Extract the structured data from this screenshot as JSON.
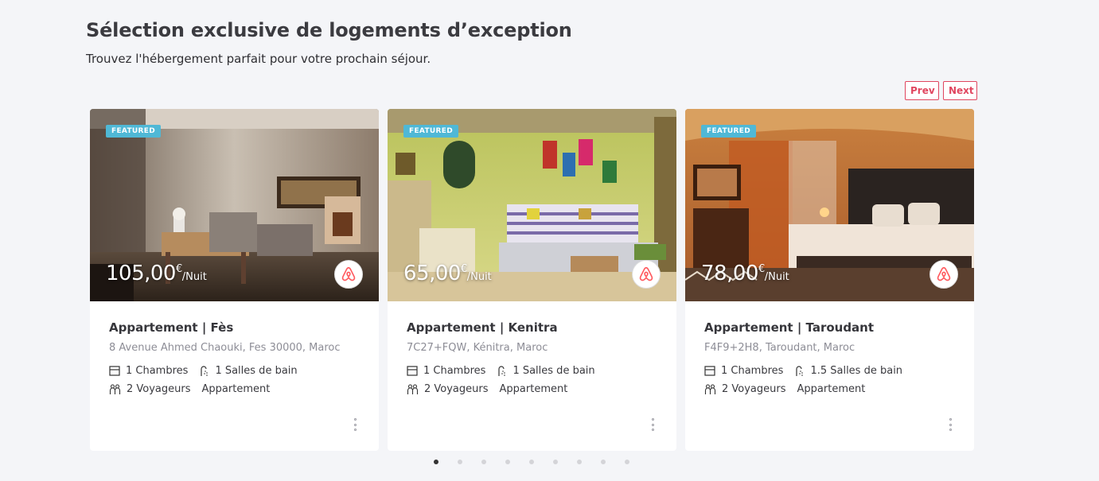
{
  "header": {
    "title": "Sélection exclusive de logements d’exception",
    "subtitle": "Trouvez l'hébergement parfait pour votre prochain séjour."
  },
  "nav": {
    "prev_label": "Prev",
    "next_label": "Next"
  },
  "cards": [
    {
      "badge": "FEATURED",
      "price": "105,00",
      "currency": "€",
      "unit": "/Nuit",
      "title": "Appartement | Fès",
      "address": "8 Avenue Ahmed Chaouki, Fes 30000, Maroc",
      "rooms": "1 Chambres",
      "baths": "1 Salles de bain",
      "guests": "2 Voyageurs",
      "type": "Appartement",
      "icon": "airbnb-icon"
    },
    {
      "badge": "FEATURED",
      "price": "65,00",
      "currency": "€",
      "unit": "/Nuit",
      "title": "Appartement | Kenitra",
      "address": "7C27+FQW, Kénitra, Maroc",
      "rooms": "1 Chambres",
      "baths": "1 Salles de bain",
      "guests": "2 Voyageurs",
      "type": "Appartement",
      "icon": "airbnb-icon"
    },
    {
      "badge": "FEATURED",
      "price": "78,00",
      "currency": "€",
      "unit": "/Nuit",
      "title": "Appartement | Taroudant",
      "address": "F4F9+2H8, Taroudant, Maroc",
      "rooms": "1 Chambres",
      "baths": "1.5 Salles de bain",
      "guests": "2 Voyageurs",
      "type": "Appartement",
      "icon": "airbnb-icon"
    }
  ],
  "pagination": {
    "count": 9,
    "active_index": 0
  },
  "colors": {
    "accent": "#e0465f",
    "badge": "#4fb8d6",
    "airbnb": "#ff5a5f"
  }
}
